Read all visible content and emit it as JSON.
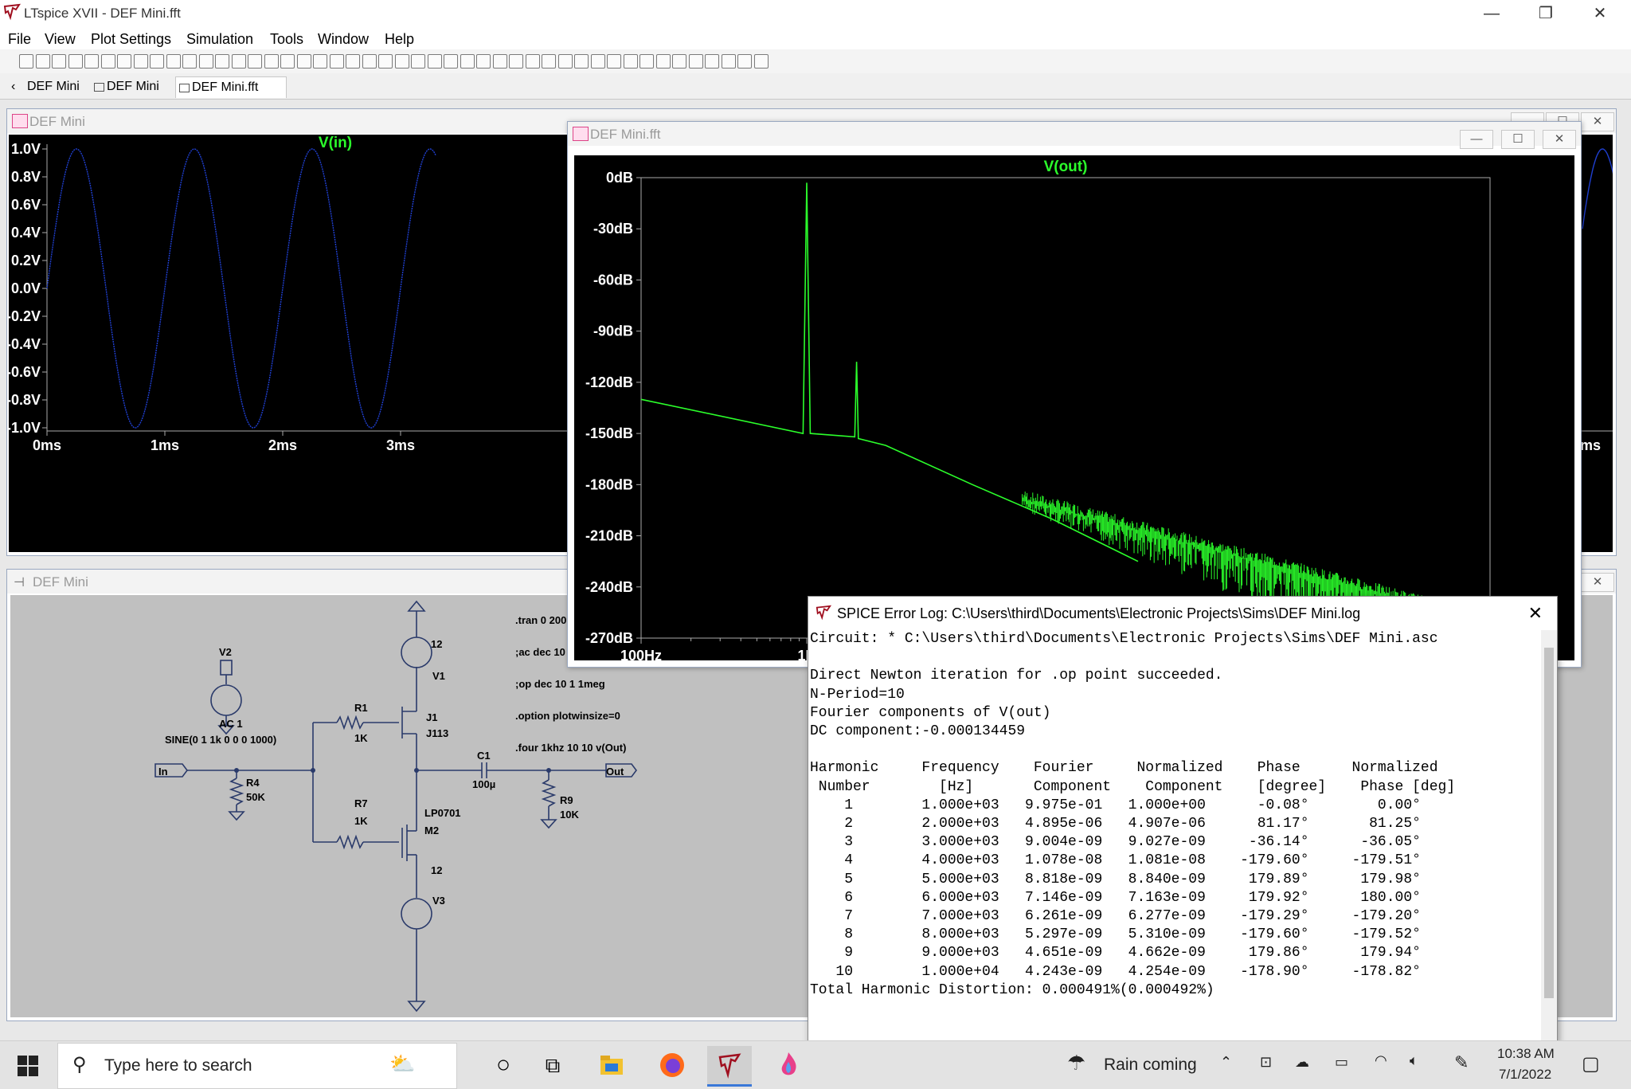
{
  "window": {
    "title": "LTspice XVII - DEF Mini.fft"
  },
  "menu": [
    "File",
    "View",
    "Plot Settings",
    "Simulation",
    "Tools",
    "Window",
    "Help"
  ],
  "tabs": [
    {
      "label": "DEF Mini",
      "active": false
    },
    {
      "label": "DEF Mini",
      "active": false
    },
    {
      "label": "DEF Mini.fft",
      "active": true
    }
  ],
  "wave_window": {
    "title": "DEF Mini",
    "trace": "V(in)",
    "y_ticks": [
      "1.0V",
      "0.8V",
      "0.6V",
      "0.4V",
      "0.2V",
      "0.0V",
      "-0.2V",
      "-0.4V",
      "-0.6V",
      "-0.8V",
      "-1.0V"
    ],
    "x_ticks": [
      "0ms",
      "1ms",
      "2ms",
      "3ms"
    ],
    "x_tick_right": "10ms"
  },
  "fft_window": {
    "title": "DEF Mini.fft",
    "trace": "V(out)",
    "y_ticks": [
      "0dB",
      "-30dB",
      "-60dB",
      "-90dB",
      "-120dB",
      "-150dB",
      "-180dB",
      "-210dB",
      "-240dB",
      "-270dB"
    ],
    "x_ticks": [
      "100Hz",
      "1K"
    ]
  },
  "chart_data": [
    {
      "type": "line",
      "title": "V(in)",
      "xlabel": "",
      "ylabel": "",
      "series": [
        {
          "name": "V(in)",
          "function": "sine",
          "amplitude": 1,
          "frequency_hz": 1000,
          "offset": 0,
          "color": "#1f3fd0"
        }
      ],
      "xlim_ms": [
        0,
        10
      ],
      "visible_x_ms": [
        0,
        3.3
      ],
      "ylim": [
        -1.0,
        1.0
      ],
      "grid": false,
      "legend": "top-center"
    },
    {
      "type": "line",
      "title": "V(out)",
      "xlabel": "",
      "ylabel": "",
      "y_unit": "dB",
      "ylim": [
        -270,
        0
      ],
      "x_scale": "log",
      "series": [
        {
          "name": "V(out)",
          "color": "#2bff2b",
          "points": [
            {
              "x": 100,
              "y": -130
            },
            {
              "x": 950,
              "y": -150
            },
            {
              "x": 1000,
              "y": -3
            },
            {
              "x": 1050,
              "y": -150
            },
            {
              "x": 1950,
              "y": -152
            },
            {
              "x": 2000,
              "y": -108
            },
            {
              "x": 2050,
              "y": -153
            },
            {
              "x": 3000,
              "y": -157
            },
            {
              "x": 10000,
              "y": -180
            },
            {
              "x": 30000,
              "y": -200
            },
            {
              "x": 100000,
              "y": -225
            }
          ],
          "noise_floor_from_hz": 20000
        }
      ],
      "grid": false,
      "legend": "top-center"
    }
  ],
  "schematic": {
    "title": "DEF Mini",
    "directives": [
      ".tran 0 200",
      ";ac dec 10",
      ";op dec 10 1 1meg",
      ".option plotwinsize=0",
      ".four 1khz 10 10 v(Out)"
    ],
    "components": {
      "v2": "V2",
      "v2_val1": "AC 1",
      "v2_val2": "SINE(0 1 1k 0 0 0 1000)",
      "v1": "V1",
      "v1_val": "12",
      "v3": "V3",
      "v3_val": "12",
      "r1": "R1",
      "r1_val": "1K",
      "r7": "R7",
      "r7_val": "1K",
      "r4": "R4",
      "r4_val": "50K",
      "r9": "R9",
      "r9_val": "10K",
      "c1": "C1",
      "c1_val": "100µ",
      "j1": "J1",
      "j1_model": "J113",
      "m2": "M2",
      "m2_model": "LP0701"
    },
    "labels": {
      "in": "In",
      "out": "Out"
    }
  },
  "error_log": {
    "title": "SPICE Error Log: C:\\Users\\third\\Documents\\Electronic Projects\\Sims\\DEF Mini.log",
    "lines": [
      "Circuit: * C:\\Users\\third\\Documents\\Electronic Projects\\Sims\\DEF Mini.asc",
      "",
      "Direct Newton iteration for .op point succeeded.",
      "N-Period=10",
      "Fourier components of V(out)",
      "DC component:-0.000134459",
      "",
      "Harmonic     Frequency    Fourier     Normalized    Phase      Normalized",
      " Number        [Hz]       Component    Component    [degree]    Phase [deg]",
      "    1        1.000e+03   9.975e-01   1.000e+00      -0.08°        0.00°",
      "    2        2.000e+03   4.895e-06   4.907e-06      81.17°       81.25°",
      "    3        3.000e+03   9.004e-09   9.027e-09     -36.14°      -36.05°",
      "    4        4.000e+03   1.078e-08   1.081e-08    -179.60°     -179.51°",
      "    5        5.000e+03   8.818e-09   8.840e-09     179.89°      179.98°",
      "    6        6.000e+03   7.146e-09   7.163e-09     179.92°      180.00°",
      "    7        7.000e+03   6.261e-09   6.277e-09    -179.29°     -179.20°",
      "    8        8.000e+03   5.297e-09   5.310e-09    -179.60°     -179.52°",
      "    9        9.000e+03   4.651e-09   4.662e-09     179.86°      179.94°",
      "   10        1.000e+04   4.243e-09   4.254e-09    -178.90°     -178.82°",
      "Total Harmonic Distortion: 0.000491%(0.000492%)"
    ]
  },
  "taskbar": {
    "search_placeholder": "Type here to search",
    "weather": "Rain coming",
    "time": "10:38 AM",
    "date": "7/1/2022"
  },
  "colors": {
    "plot_bg": "#000000",
    "axis": "#aaaaaa",
    "tick_text": "#ffffff",
    "vin_trace": "#1f3fd0",
    "vout_trace": "#2bff2b",
    "trace_title": "#2bff2b",
    "schematic_bg": "#c0c0c0"
  }
}
